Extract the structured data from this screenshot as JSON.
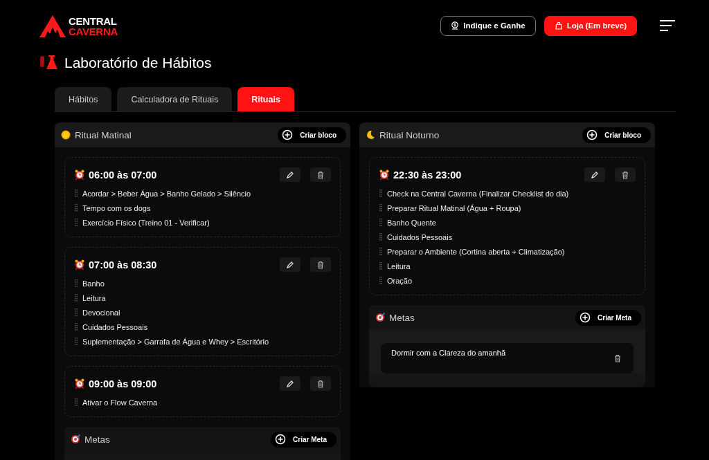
{
  "header": {
    "logo": {
      "line_1": "CENTRAL",
      "line_2": "CAVERNA"
    },
    "buttons": [
      {
        "kind": "referral",
        "label": "Indique e Ganhe"
      },
      {
        "kind": "shop",
        "label": "Loja (Em breve)"
      }
    ]
  },
  "page_title": "Laboratório de Hábitos",
  "tabs": [
    {
      "label": "Hábitos",
      "selected": false
    },
    {
      "label": "Calculadora de Rituais",
      "selected": false
    },
    {
      "label": "Rituais",
      "selected": true
    }
  ],
  "columns": [
    {
      "kind": "morning",
      "title": "Ritual Matinal",
      "button": "Criar bloco",
      "blocks": [
        {
          "time": "06:00 às 07:00",
          "items": [
            "Acordar > Beber Água > Banho Gelado > Silêncio",
            "Tempo com os dogs",
            "Exercício Físico (Treino 01 - Verificar)"
          ]
        },
        {
          "time": "07:00 às 08:30",
          "items": [
            "Banho",
            "Leitura",
            "Devocional",
            "Cuidados Pessoais",
            "Suplementação > Garrafa de Água e Whey > Escritório"
          ]
        },
        {
          "time": "09:00 às 09:00",
          "items": [
            "Ativar o Flow Caverna"
          ]
        }
      ],
      "goals": {
        "title": "Metas",
        "button": "Criar Meta"
      }
    },
    {
      "kind": "night",
      "title": "Ritual Noturno",
      "button": "Criar bloco",
      "blocks": [
        {
          "time": "22:30 às 23:00",
          "items": [
            "Check na Central Caverna (Finalizar Checklist do dia)",
            "Preparar Ritual Matinal (Água + Roupa)",
            "Banho Quente",
            "Cuidados Pessoais",
            "Preparar o Ambiente (Cortina aberta + Climatização)",
            "Leitura",
            "Oração"
          ]
        }
      ],
      "goals": {
        "title": "Metas",
        "button": "Criar Meta",
        "items": [
          "Dormir com a Clareza do amanhã"
        ]
      }
    }
  ]
}
